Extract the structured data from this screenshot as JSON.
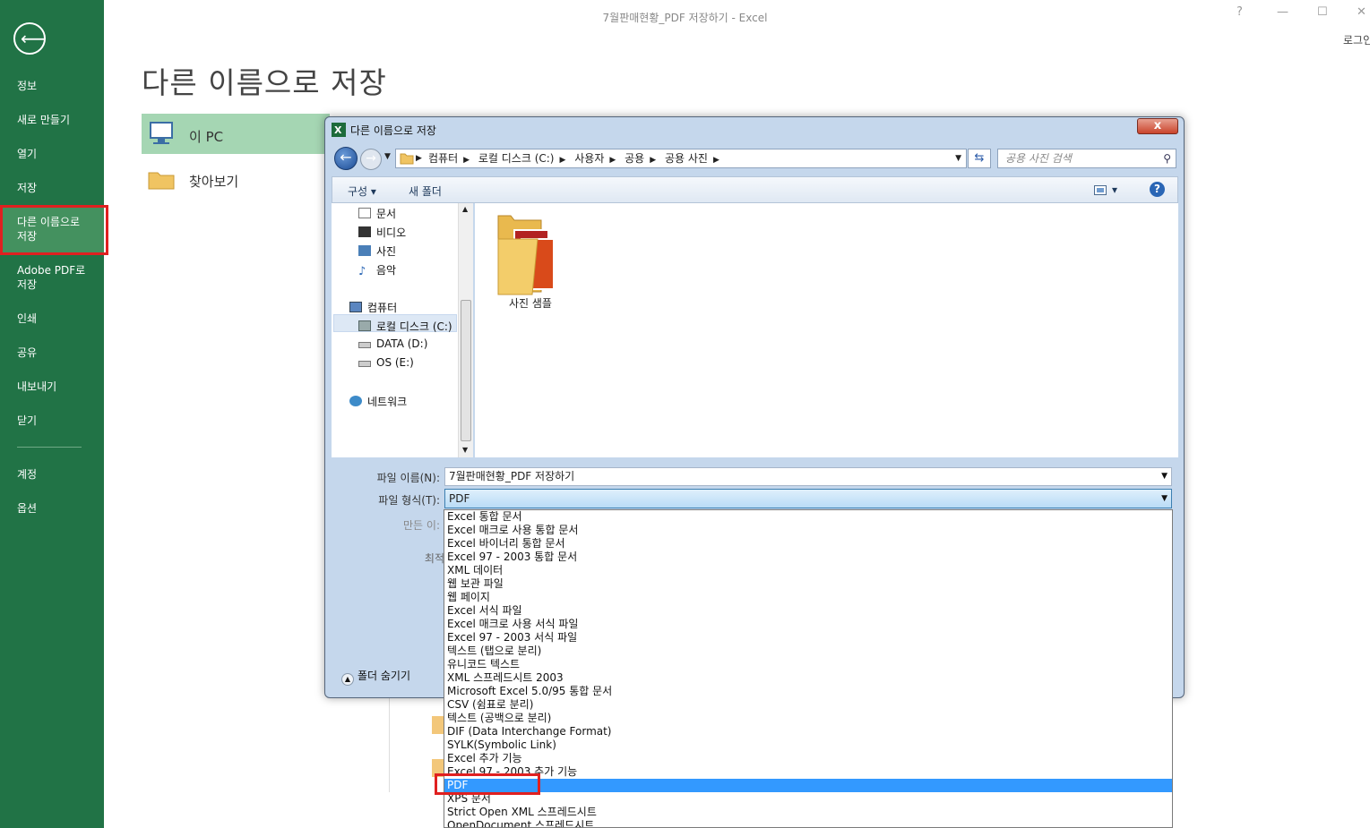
{
  "window": {
    "title": "7월판매현황_PDF 저장하기 - Excel",
    "help": "?",
    "minimize": "—",
    "maximize": "☐",
    "close": "✕",
    "login": "로그인"
  },
  "sidebar": {
    "back_icon": "arrow-left-icon",
    "items": [
      {
        "label": "정보"
      },
      {
        "label": "새로 만들기"
      },
      {
        "label": "열기"
      },
      {
        "label": "저장"
      },
      {
        "label": "다른 이름으로\n저장",
        "active": true
      },
      {
        "label": "Adobe PDF로\n저장"
      },
      {
        "label": "인쇄"
      },
      {
        "label": "공유"
      },
      {
        "label": "내보내기"
      },
      {
        "label": "닫기"
      },
      {
        "label": "계정"
      },
      {
        "label": "옵션"
      }
    ]
  },
  "page": {
    "title": "다른 이름으로 저장",
    "places": [
      {
        "label": "이 PC",
        "icon": "computer-icon"
      },
      {
        "label": "찾아보기",
        "icon": "folder-icon"
      }
    ]
  },
  "dialog": {
    "title": "다른 이름으로 저장",
    "close_label": "x",
    "address": [
      "컴퓨터",
      "로컬 디스크 (C:)",
      "사용자",
      "공용",
      "공용 사진"
    ],
    "search_placeholder": "공용 사진 검색",
    "toolbar": {
      "organize": "구성 ▾",
      "new_folder": "새 폴더",
      "view": "▾"
    },
    "nav": [
      {
        "label": "문서",
        "icon": "document-icon"
      },
      {
        "label": "비디오",
        "icon": "video-icon"
      },
      {
        "label": "사진",
        "icon": "picture-icon"
      },
      {
        "label": "음악",
        "icon": "music-icon"
      },
      {
        "label": "컴퓨터",
        "icon": "computer-icon"
      },
      {
        "label": "로컬 디스크 (C:)",
        "icon": "drive-icon",
        "selected": true
      },
      {
        "label": "DATA (D:)",
        "icon": "drive-icon"
      },
      {
        "label": "OS (E:)",
        "icon": "drive-icon"
      },
      {
        "label": "네트워크",
        "icon": "network-icon"
      }
    ],
    "folder": {
      "label": "사진 샘플"
    },
    "filename_label": "파일 이름(N):",
    "filename_value": "7월판매현황_PDF 저장하기",
    "filetype_label": "파일 형식(T):",
    "filetype_value": "PDF",
    "author_label": "만든 이:",
    "optimize_label": "최적",
    "hide_folders": "폴더 숨기기"
  },
  "type_options": [
    "Excel 통합 문서",
    "Excel 매크로 사용 통합 문서",
    "Excel 바이너리 통합 문서",
    "Excel 97 - 2003 통합 문서",
    "XML 데이터",
    "웹 보관 파일",
    "웹 페이지",
    "Excel 서식 파일",
    "Excel 매크로 사용 서식 파일",
    "Excel 97 - 2003 서식 파일",
    "텍스트 (탭으로 분리)",
    "유니코드 텍스트",
    "XML 스프레드시트 2003",
    "Microsoft Excel 5.0/95 통합 문서",
    "CSV (쉼표로 분리)",
    "텍스트 (공백으로 분리)",
    "DIF (Data Interchange Format)",
    "SYLK(Symbolic Link)",
    "Excel 추가 기능",
    "Excel 97 - 2003 추가 기능",
    "PDF",
    "XPS 문서",
    "Strict Open XML 스프레드시트",
    "OpenDocument 스프레드시트"
  ],
  "selected_option_index": 20,
  "colors": {
    "sidebar": "#217346",
    "highlight": "#e02020",
    "selection": "#3399ff"
  }
}
